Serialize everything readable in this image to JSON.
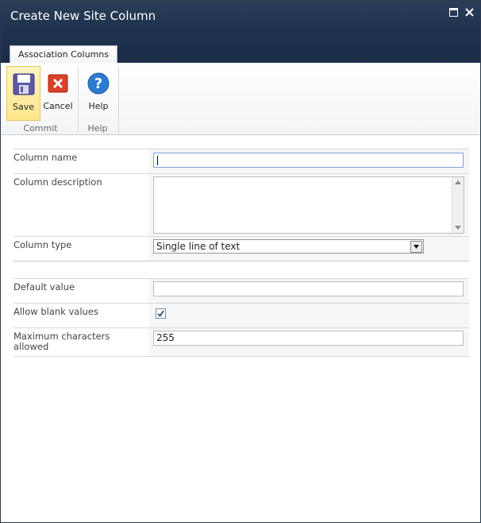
{
  "window": {
    "title": "Create New Site Column"
  },
  "ribbon": {
    "tab": "Association Columns",
    "buttons": {
      "save": "Save",
      "cancel": "Cancel",
      "help": "Help"
    },
    "groups": {
      "commit": "Commit",
      "help": "Help"
    }
  },
  "form": {
    "column_name": {
      "label": "Column name",
      "value": ""
    },
    "column_description": {
      "label": "Column description",
      "value": ""
    },
    "column_type": {
      "label": "Column type",
      "value": "Single line of text"
    },
    "default_value": {
      "label": "Default value",
      "value": ""
    },
    "allow_blank": {
      "label": "Allow blank values",
      "checked": true
    },
    "max_chars": {
      "label": "Maximum characters allowed",
      "value": "255"
    }
  },
  "colors": {
    "titlebar": "#1f3350",
    "save_highlight": "#ffe68a",
    "cancel_red": "#d9412a",
    "help_blue": "#2b7bd1"
  },
  "icons": [
    "floppy-disk-icon",
    "cancel-x-icon",
    "help-question-icon",
    "maximize-icon",
    "close-icon",
    "dropdown-arrow-icon",
    "checkmark-icon"
  ]
}
